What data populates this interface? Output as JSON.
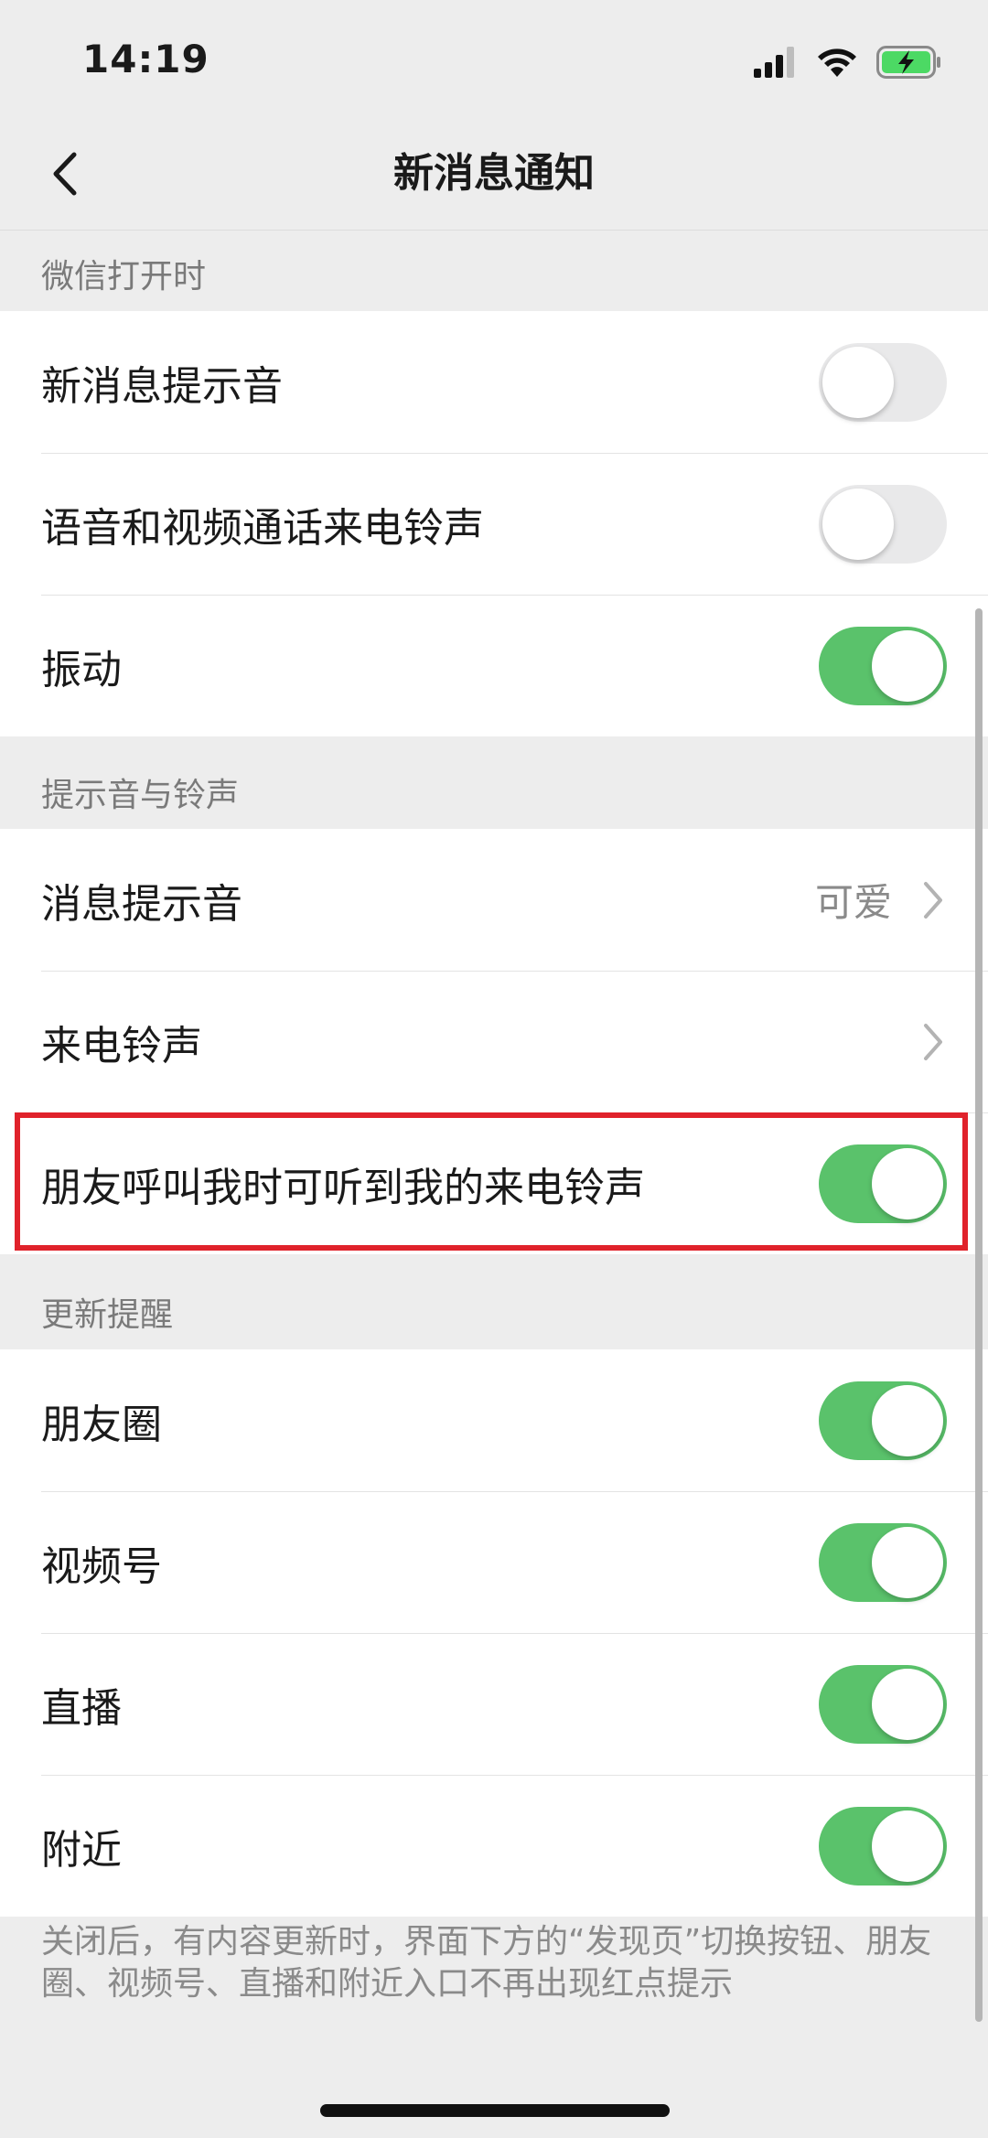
{
  "status_bar": {
    "time": "14:19"
  },
  "nav": {
    "title": "新消息通知",
    "back_icon": "chevron-left-icon"
  },
  "sections": {
    "when_open": {
      "header": "微信打开时",
      "rows": [
        {
          "label": "新消息提示音",
          "toggle": "off"
        },
        {
          "label": "语音和视频通话来电铃声",
          "toggle": "off"
        },
        {
          "label": "振动",
          "toggle": "on"
        }
      ]
    },
    "sounds": {
      "header": "提示音与铃声",
      "rows": [
        {
          "label": "消息提示音",
          "value": "可爱"
        },
        {
          "label": "来电铃声"
        },
        {
          "label": "朋友呼叫我时可听到我的来电铃声",
          "toggle": "on"
        }
      ]
    },
    "updates": {
      "header": "更新提醒",
      "rows": [
        {
          "label": "朋友圈",
          "toggle": "on"
        },
        {
          "label": "视频号",
          "toggle": "on"
        },
        {
          "label": "直播",
          "toggle": "on"
        },
        {
          "label": "附近",
          "toggle": "on"
        }
      ]
    }
  },
  "footnote": "关闭后，有内容更新时，界面下方的“发现页”切换按钮、朋友圈、视频号、直播和附近入口不再出现红点提示",
  "colors": {
    "toggle_on": "#5ac26b",
    "toggle_off": "#e9e9ea",
    "highlight": "#e0222b",
    "background": "#ededed"
  }
}
